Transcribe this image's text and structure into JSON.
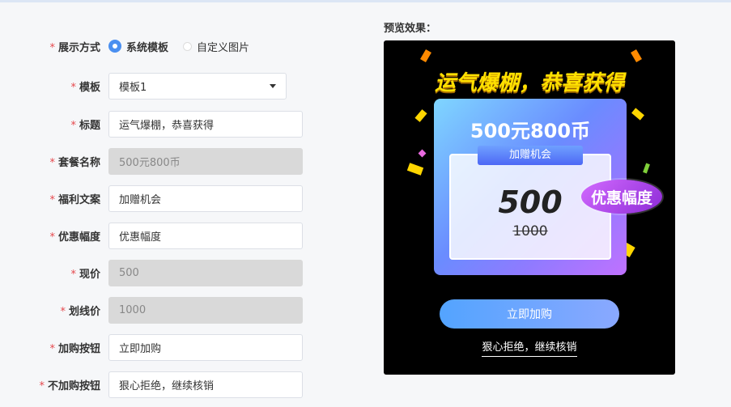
{
  "form": {
    "display_mode": {
      "label": "展示方式",
      "options": [
        {
          "label": "系统模板",
          "checked": true
        },
        {
          "label": "自定义图片",
          "checked": false
        }
      ]
    },
    "template": {
      "label": "模板",
      "value": "模板1"
    },
    "title": {
      "label": "标题",
      "value": "运气爆棚，恭喜获得"
    },
    "package_name": {
      "label": "套餐名称",
      "value": "500元800币"
    },
    "benefit_text": {
      "label": "福利文案",
      "value": "加赠机会"
    },
    "discount": {
      "label": "优惠幅度",
      "value": "优惠幅度"
    },
    "current_price": {
      "label": "现价",
      "value": "500"
    },
    "strike_price": {
      "label": "划线价",
      "value": "1000"
    },
    "buy_button": {
      "label": "加购按钮",
      "value": "立即加购"
    },
    "no_buy_button": {
      "label": "不加购按钮",
      "value": "狠心拒绝，继续核销"
    }
  },
  "preview": {
    "heading": "预览效果：",
    "headline": "运气爆棚，恭喜获得",
    "package": "500元800币",
    "bonus": "加赠机会",
    "price": "500",
    "original_price": "1000",
    "discount_badge": "优惠幅度",
    "buy_label": "立即加购",
    "refuse_label": "狠心拒绝，继续核销"
  },
  "colors": {
    "required_star": "#e5484d",
    "radio_accent": "#4a8ff0",
    "headline": "#ffe000",
    "buy_button": "#53a4ff"
  }
}
